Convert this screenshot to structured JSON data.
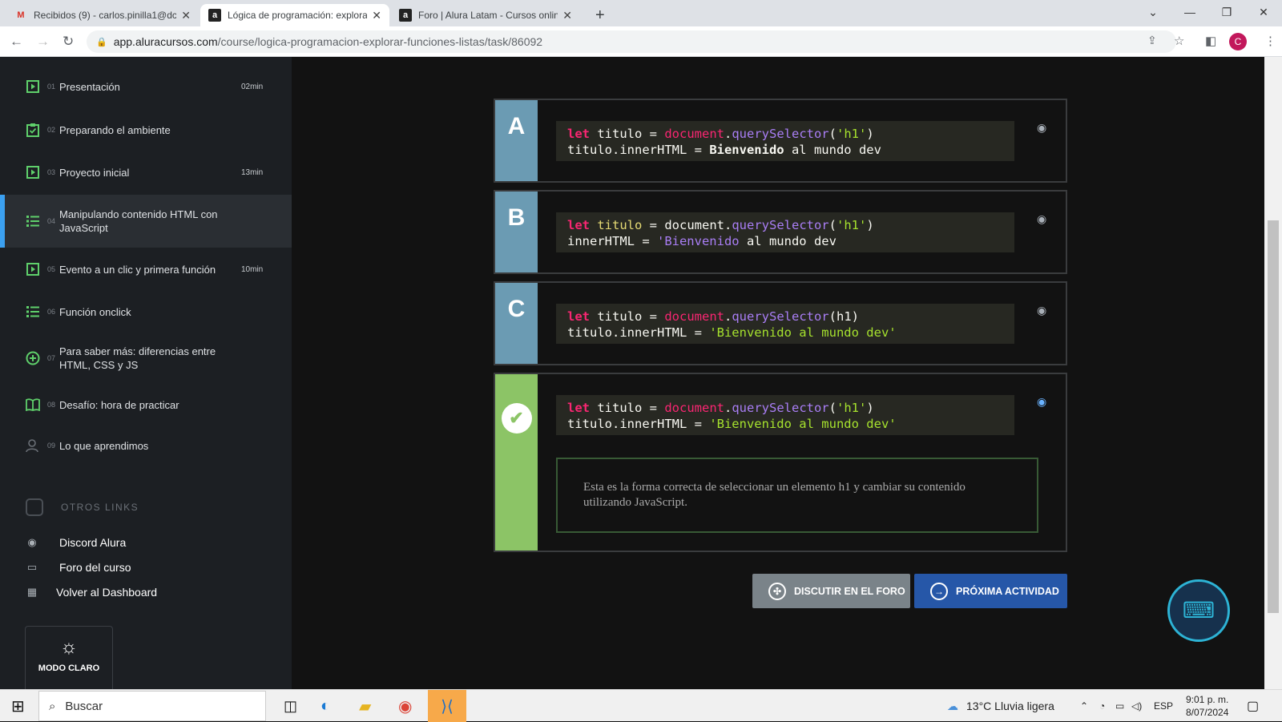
{
  "browser": {
    "tabs": [
      {
        "icon": "M",
        "title": "Recibidos (9) - carlos.pinilla1@dc"
      },
      {
        "icon": "a",
        "title": "Lógica de programación: explora"
      },
      {
        "icon": "a",
        "title": "Foro | Alura Latam - Cursos onlin"
      }
    ],
    "new_tab": "+",
    "url_host": "app.aluracursos.com",
    "url_path": "/course/logica-programacion-explorar-funciones-listas/task/86092",
    "avatar_letter": "C"
  },
  "sidebar": {
    "items": [
      {
        "num": "01",
        "label": "Presentación",
        "duration": "02min",
        "icon": "play-icon"
      },
      {
        "num": "02",
        "label": "Preparando el ambiente",
        "duration": "",
        "icon": "clipboard-icon"
      },
      {
        "num": "03",
        "label": "Proyecto inicial",
        "duration": "13min",
        "icon": "play-icon"
      },
      {
        "num": "04",
        "label": "Manipulando contenido HTML con JavaScript",
        "duration": "",
        "icon": "list-icon"
      },
      {
        "num": "05",
        "label": "Evento a un clic y primera función",
        "duration": "10min",
        "icon": "play-icon"
      },
      {
        "num": "06",
        "label": "Función onclick",
        "duration": "",
        "icon": "list-icon"
      },
      {
        "num": "07",
        "label": "Para saber más: diferencias entre HTML, CSS y JS",
        "duration": "",
        "icon": "plus-circle-icon"
      },
      {
        "num": "08",
        "label": "Desafío: hora de practicar",
        "duration": "",
        "icon": "book-icon"
      },
      {
        "num": "09",
        "label": "Lo que aprendimos",
        "duration": "",
        "icon": "user-icon"
      }
    ],
    "otros_links_title": "OTROS LINKS",
    "links": [
      "Discord Alura",
      "Foro del curso",
      "Volver al Dashboard"
    ],
    "mode_label": "MODO CLARO"
  },
  "options": [
    {
      "letter": "A",
      "line1": [
        "let",
        " titulo = ",
        "document",
        ".",
        "querySelector",
        "(",
        "'h1'",
        ")"
      ],
      "line2": [
        "titulo.innerHTML = ",
        "Bienvenido",
        " al mundo dev"
      ]
    },
    {
      "letter": "B",
      "line1": [
        "let",
        " ",
        "titulo",
        " = document.",
        "querySelector",
        "(",
        "'h1'",
        ")"
      ],
      "line2": [
        "innerHTML = ",
        "'Bienvenido",
        " al mundo dev"
      ]
    },
    {
      "letter": "C",
      "line1": [
        "let",
        " titulo = ",
        "document",
        ".",
        "querySelector",
        "(h1)"
      ],
      "line2": [
        "titulo.innerHTML = ",
        "'Bienvenido al mundo dev'"
      ]
    },
    {
      "letter": "",
      "line1": [
        "let",
        " titulo = ",
        "document",
        ".",
        "querySelector",
        "(",
        "'h1'",
        ")"
      ],
      "line2": [
        "titulo.innerHTML = ",
        "'Bienvenido al mundo dev'"
      ],
      "explanation": "Esta es la forma correcta de seleccionar un elemento h1 y cambiar su contenido utilizando JavaScript."
    }
  ],
  "buttons": {
    "forum": "DISCUTIR EN EL FORO",
    "next": "PRÓXIMA ACTIVIDAD"
  },
  "taskbar": {
    "search": "Buscar",
    "weather": "13°C  Lluvia ligera",
    "lang": "ESP",
    "time": "9:01 p. m.",
    "date": "8/07/2024"
  },
  "colors": {
    "accent_blue": "#3ba0f0",
    "correct_green": "#8cc466",
    "option_blue": "#6b9bb3",
    "next_button": "#2657a8",
    "forum_button": "#7a8389"
  }
}
